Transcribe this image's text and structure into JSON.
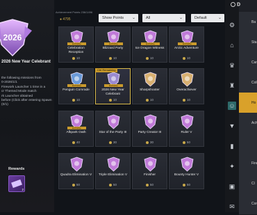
{
  "featured": {
    "title": "2026 New Year Celebrant",
    "description": "the following missions from\n0-2026/1/1\nFirework Launcher 1 time in a\ncr Themed Mode match\nrk Launcher obtained\nbefore (Click after entering Spawn\n(0/1)"
  },
  "rewards": {
    "label": "Rewards",
    "qty": "2"
  },
  "header": {
    "stats": "Achievement Points   236/1496",
    "points": "4795",
    "filters": [
      "Show Points",
      "All",
      "Default"
    ]
  },
  "colors": {
    "accent": "#d9a12a",
    "selected_border": "#d9b94a",
    "rail_active": "#2e6a6a"
  },
  "achievements": [
    {
      "name": "Celebration Reception",
      "tag": "Exclusive",
      "points": "10",
      "color": "#c07ad8"
    },
    {
      "name": "Blizzard Party",
      "tag": "Exclusive",
      "points": "10",
      "color": "#c07ad8"
    },
    {
      "name": "Ice Dragon Witness",
      "tag": "Exclusive",
      "points": "10",
      "color": "#c07ad8"
    },
    {
      "name": "Arctic Adventure",
      "tag": "Exclusive",
      "points": "10",
      "color": "#c07ad8"
    },
    {
      "name": "Penguin Comrade",
      "tag": "Exclusive",
      "points": "10",
      "color": "#6a9ad8"
    },
    {
      "name": "2026 New Year Celebrant",
      "tag": "Exclusive",
      "points": "10",
      "color": "#9a8ad0",
      "ribbon": "Ctrl Remaining",
      "selected": true
    },
    {
      "name": "Sharpshooter",
      "tag": "",
      "points": "10",
      "color": "#d8b070"
    },
    {
      "name": "Overachiever",
      "tag": "",
      "points": "10",
      "color": "#d8b070"
    },
    {
      "name": "Afkpark Oath",
      "tag": "Exclusive",
      "points": "40",
      "color": "#c07ad8"
    },
    {
      "name": "Star of the Party III",
      "tag": "",
      "points": "30",
      "color": "#c07ad8"
    },
    {
      "name": "Party Creator III",
      "tag": "",
      "points": "30",
      "color": "#c07ad8"
    },
    {
      "name": "Ruler V",
      "tag": "",
      "points": "50",
      "color": "#c07ad8"
    },
    {
      "name": "Quadra Elimination V",
      "tag": "",
      "points": "50",
      "color": "#c07ad8"
    },
    {
      "name": "Triple Elimination V",
      "tag": "",
      "points": "50",
      "color": "#c07ad8"
    },
    {
      "name": "Finisher",
      "tag": "",
      "points": "50",
      "color": "#c07ad8"
    },
    {
      "name": "Bounty Hunter V",
      "tag": "",
      "points": "50",
      "color": "#c07ad8"
    }
  ],
  "rail_icons": [
    "gear-icon",
    "home-icon",
    "trophy-icon",
    "cup-icon",
    "users-icon",
    "tshirt-icon",
    "bookmark-icon",
    "fireworks-icon",
    "photo-icon",
    "chat-icon"
  ],
  "categories": [
    {
      "label": "Ba"
    },
    {
      "label": "Sta"
    },
    {
      "label": "Care"
    },
    {
      "label": "Colle"
    },
    {
      "label": "Ho",
      "active": true
    },
    {
      "label": "Achie"
    },
    {
      "label": ""
    },
    {
      "label": "Firewor"
    },
    {
      "label": "Cl"
    },
    {
      "label": "Conn"
    }
  ],
  "topbar": {
    "label": "D"
  }
}
